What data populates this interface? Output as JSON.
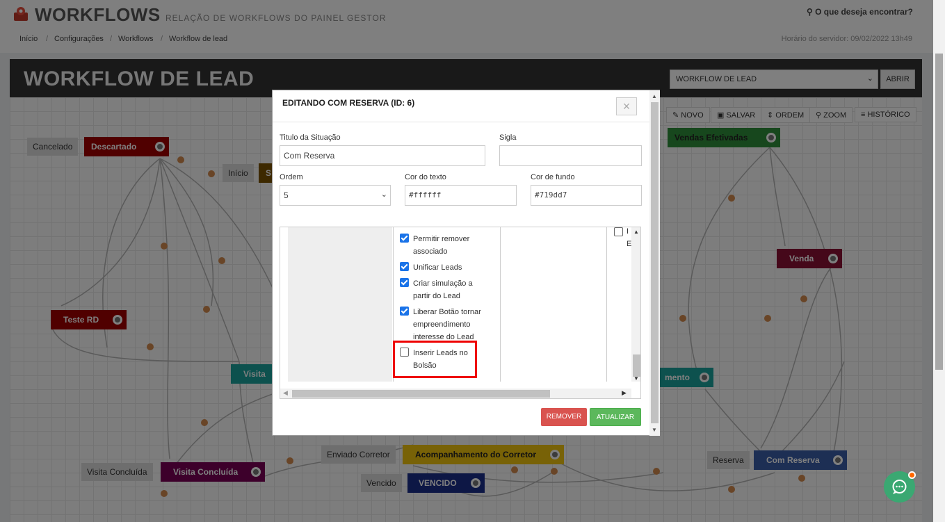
{
  "header": {
    "title": "WORKFLOWS",
    "subtitle": "RELAÇÃO DE WORKFLOWS DO PAINEL GESTOR",
    "search_label": "O que deseja encontrar?"
  },
  "breadcrumb": {
    "items": [
      "Início",
      "/",
      "Configurações",
      "/",
      "Workflows",
      "/",
      "Workflow de lead"
    ],
    "server_time": "Horário do servidor: 09/02/2022 13h49"
  },
  "workflow": {
    "title": "WORKFLOW DE LEAD",
    "select_value": "WORKFLOW DE LEAD",
    "open_label": "ABRIR"
  },
  "toolbar": {
    "novo": "NOVO",
    "salvar": "SALVAR",
    "ordem": "ORDEM",
    "zoom": "ZOOM",
    "historico": "HISTÓRICO"
  },
  "nodes": {
    "cancelado_lbl": "Cancelado",
    "descartado": "Descartado",
    "inicio_lbl": "Início",
    "s": "S",
    "vendas": "Vendas Efetivadas",
    "venda": "Venda",
    "teste": "Teste RD",
    "visita": "Visita",
    "mento": "mento",
    "visita_conc_lbl": "Visita Concluída",
    "visita_conc": "Visita Concluída",
    "enviado_lbl": "Enviado Corretor",
    "acomp": "Acompanhamento do Corretor",
    "vencido_lbl": "Vencido",
    "vencido": "VENCIDO",
    "reserva_lbl": "Reserva",
    "com_reserva": "Com Reserva"
  },
  "colors": {
    "descartado": "#a10000",
    "vendas": "#2f8f3a",
    "venda": "#8b1035",
    "teste": "#a10000",
    "visita": "#1ba39c",
    "visita_conc": "#7a0057",
    "acomp": "#f1c40f",
    "vencido": "#1a2f8a",
    "com_reserva": "#3a5fa8",
    "s": "#7a5200"
  },
  "modal": {
    "title": "EDITANDO COM RESERVA (ID: 6)",
    "close": "×",
    "titulo_label": "Titulo da Situação",
    "titulo_value": "Com Reserva",
    "sigla_label": "Sigla",
    "sigla_value": "",
    "ordem_label": "Ordem",
    "ordem_value": "5",
    "cor_texto_label": "Cor do texto",
    "cor_texto_value": "#ffffff",
    "cor_fundo_label": "Cor de fundo",
    "cor_fundo_value": "#719dd7",
    "permissions": [
      {
        "label": "Permitir remover associado",
        "checked": true
      },
      {
        "label": "Unificar Leads",
        "checked": true
      },
      {
        "label": "Criar simulação a partir do Lead",
        "checked": true
      },
      {
        "label": "Liberar Botão tornar empreendimento interesse do Lead",
        "checked": true
      },
      {
        "label": "Inserir Leads no Bolsão",
        "checked": false
      }
    ],
    "col3_partial_1": "I",
    "col3_partial_2": "E",
    "remove_label": "REMOVER",
    "update_label": "ATUALIZAR"
  }
}
